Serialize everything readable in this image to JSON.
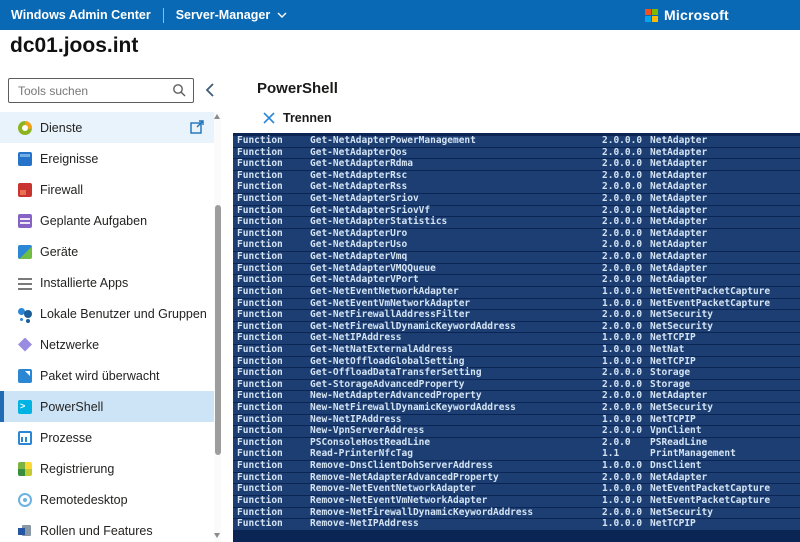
{
  "topbar": {
    "app_title": "Windows Admin Center",
    "solution": "Server-Manager",
    "dropdown_icon": "chevron-down-icon",
    "brand": "Microsoft"
  },
  "page": {
    "title": "dc01.joos.int"
  },
  "sidebar": {
    "search_placeholder": "Tools suchen",
    "search_icon": "search-icon",
    "collapse_icon": "chevron-left-icon",
    "items": [
      {
        "name": "services",
        "label": "Dienste",
        "icon": "services-gear-icon",
        "state": "highlighted",
        "popup": true
      },
      {
        "name": "events",
        "label": "Ereignisse",
        "icon": "events-icon"
      },
      {
        "name": "firewall",
        "label": "Firewall",
        "icon": "firewall-icon"
      },
      {
        "name": "scheduled-tasks",
        "label": "Geplante Aufgaben",
        "icon": "scheduled-tasks-icon"
      },
      {
        "name": "devices",
        "label": "Geräte",
        "icon": "devices-icon"
      },
      {
        "name": "installed-apps",
        "label": "Installierte Apps",
        "icon": "installed-apps-icon"
      },
      {
        "name": "local-users-groups",
        "label": "Lokale Benutzer und Gruppen",
        "icon": "users-groups-icon"
      },
      {
        "name": "networks",
        "label": "Netzwerke",
        "icon": "network-icon"
      },
      {
        "name": "packet-monitoring",
        "label": "Paket wird überwacht",
        "icon": "package-monitor-icon"
      },
      {
        "name": "powershell",
        "label": "PowerShell",
        "icon": "powershell-icon",
        "state": "selected"
      },
      {
        "name": "processes",
        "label": "Prozesse",
        "icon": "processes-icon"
      },
      {
        "name": "registry",
        "label": "Registrierung",
        "icon": "registry-icon"
      },
      {
        "name": "remote-desktop",
        "label": "Remotedesktop",
        "icon": "remote-desktop-icon"
      },
      {
        "name": "roles-features",
        "label": "Rollen und Features",
        "icon": "roles-features-icon"
      }
    ],
    "scrollbar": {
      "up_icon": "scroll-up-icon",
      "down_icon": "scroll-down-icon"
    }
  },
  "main": {
    "title": "PowerShell",
    "disconnect_label": "Trennen",
    "disconnect_icon": "x-icon"
  },
  "console": {
    "rows": [
      [
        "Function",
        "Get-NetAdapterPowerManagement",
        "2.0.0.0",
        "NetAdapter"
      ],
      [
        "Function",
        "Get-NetAdapterQos",
        "2.0.0.0",
        "NetAdapter"
      ],
      [
        "Function",
        "Get-NetAdapterRdma",
        "2.0.0.0",
        "NetAdapter"
      ],
      [
        "Function",
        "Get-NetAdapterRsc",
        "2.0.0.0",
        "NetAdapter"
      ],
      [
        "Function",
        "Get-NetAdapterRss",
        "2.0.0.0",
        "NetAdapter"
      ],
      [
        "Function",
        "Get-NetAdapterSriov",
        "2.0.0.0",
        "NetAdapter"
      ],
      [
        "Function",
        "Get-NetAdapterSriovVf",
        "2.0.0.0",
        "NetAdapter"
      ],
      [
        "Function",
        "Get-NetAdapterStatistics",
        "2.0.0.0",
        "NetAdapter"
      ],
      [
        "Function",
        "Get-NetAdapterUro",
        "2.0.0.0",
        "NetAdapter"
      ],
      [
        "Function",
        "Get-NetAdapterUso",
        "2.0.0.0",
        "NetAdapter"
      ],
      [
        "Function",
        "Get-NetAdapterVmq",
        "2.0.0.0",
        "NetAdapter"
      ],
      [
        "Function",
        "Get-NetAdapterVMQQueue",
        "2.0.0.0",
        "NetAdapter"
      ],
      [
        "Function",
        "Get-NetAdapterVPort",
        "2.0.0.0",
        "NetAdapter"
      ],
      [
        "Function",
        "Get-NetEventNetworkAdapter",
        "1.0.0.0",
        "NetEventPacketCapture"
      ],
      [
        "Function",
        "Get-NetEventVmNetworkAdapter",
        "1.0.0.0",
        "NetEventPacketCapture"
      ],
      [
        "Function",
        "Get-NetFirewallAddressFilter",
        "2.0.0.0",
        "NetSecurity"
      ],
      [
        "Function",
        "Get-NetFirewallDynamicKeywordAddress",
        "2.0.0.0",
        "NetSecurity"
      ],
      [
        "Function",
        "Get-NetIPAddress",
        "1.0.0.0",
        "NetTCPIP"
      ],
      [
        "Function",
        "Get-NetNatExternalAddress",
        "1.0.0.0",
        "NetNat"
      ],
      [
        "Function",
        "Get-NetOffloadGlobalSetting",
        "1.0.0.0",
        "NetTCPIP"
      ],
      [
        "Function",
        "Get-OffloadDataTransferSetting",
        "2.0.0.0",
        "Storage"
      ],
      [
        "Function",
        "Get-StorageAdvancedProperty",
        "2.0.0.0",
        "Storage"
      ],
      [
        "Function",
        "New-NetAdapterAdvancedProperty",
        "2.0.0.0",
        "NetAdapter"
      ],
      [
        "Function",
        "New-NetFirewallDynamicKeywordAddress",
        "2.0.0.0",
        "NetSecurity"
      ],
      [
        "Function",
        "New-NetIPAddress",
        "1.0.0.0",
        "NetTCPIP"
      ],
      [
        "Function",
        "New-VpnServerAddress",
        "2.0.0.0",
        "VpnClient"
      ],
      [
        "Function",
        "PSConsoleHostReadLine",
        "2.0.0",
        "PSReadLine"
      ],
      [
        "Function",
        "Read-PrinterNfcTag",
        "1.1",
        "PrintManagement"
      ],
      [
        "Function",
        "Remove-DnsClientDohServerAddress",
        "1.0.0.0",
        "DnsClient"
      ],
      [
        "Function",
        "Remove-NetAdapterAdvancedProperty",
        "2.0.0.0",
        "NetAdapter"
      ],
      [
        "Function",
        "Remove-NetEventNetworkAdapter",
        "1.0.0.0",
        "NetEventPacketCapture"
      ],
      [
        "Function",
        "Remove-NetEventVmNetworkAdapter",
        "1.0.0.0",
        "NetEventPacketCapture"
      ],
      [
        "Function",
        "Remove-NetFirewallDynamicKeywordAddress",
        "2.0.0.0",
        "NetSecurity"
      ],
      [
        "Function",
        "Remove-NetIPAddress",
        "1.0.0.0",
        "NetTCPIP"
      ]
    ]
  },
  "colors": {
    "topbar_bg": "#0a69b4",
    "accent": "#0078d4",
    "highlighted_item_bg": "#e9f3fb",
    "selected_item_bg": "#cde4f6",
    "selected_item_accent": "#1f6cb5",
    "console_bg": "#0a2453",
    "console_row_bg": "#1d3e72",
    "console_text": "#d3e3f3",
    "ms_logo_red": "#f25022",
    "ms_logo_green": "#7fba00",
    "ms_logo_blue": "#00a4ef",
    "ms_logo_yellow": "#ffb900"
  }
}
